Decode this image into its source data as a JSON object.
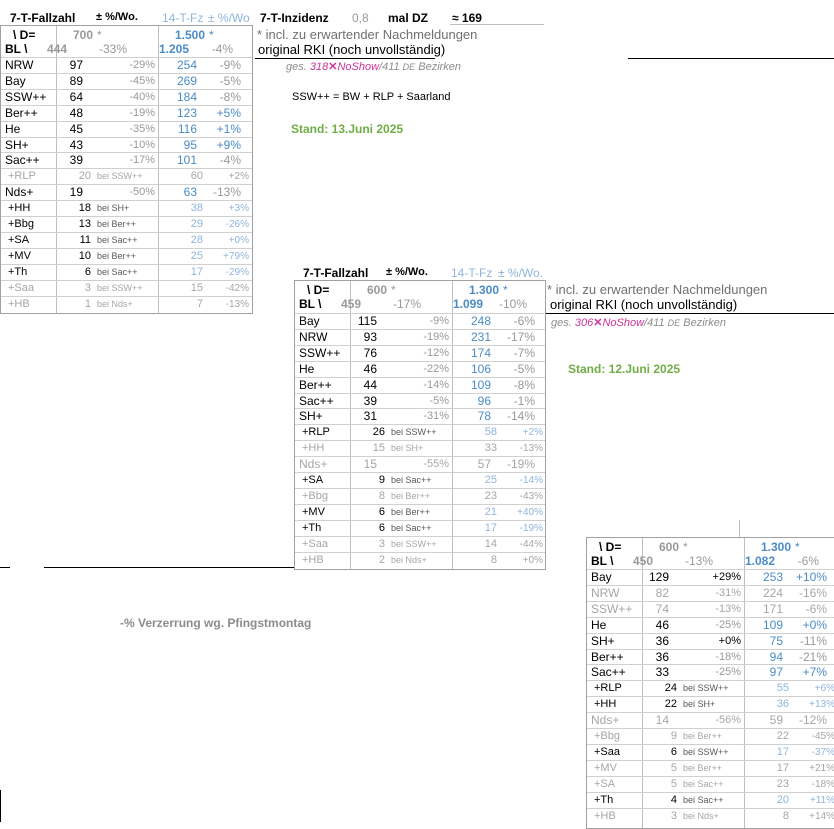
{
  "header": {
    "fallzahl_label": "7-T-Fallzahl",
    "pm_label": "± %/Wo.",
    "fz14_label": "14-T-Fz",
    "pm14_label": "± %/Wo",
    "inzidenz_label": "7-T-Inzidenz",
    "inzidenz_value": "0,8",
    "mal_dz": "mal DZ",
    "approx": "≈ 169"
  },
  "notes": {
    "incl_note": "* incl. zu erwartender Nachmeldungen",
    "original_note": "original RKI (noch unvollständig)",
    "ssw_formula": "SSW++  =  BW + RLP + Saarland",
    "pfingst": "-% Verzerrung wg. Pfingstmontag"
  },
  "table1": {
    "d_label": "\\ D=",
    "d_val": "700",
    "d_star": "*",
    "d14_val": "1.500",
    "d14_star": "*",
    "bl_label": "BL \\",
    "bl_val": "444",
    "bl_pct": "-33%",
    "bl14_val": "1.205",
    "bl14_pct": "-4%",
    "ges_prefix": "ges.",
    "ges_val": "318",
    "noshow_mark": "✕",
    "noshow": "NoShow",
    "ges_total": "/411",
    "de": "DE",
    "bezirken": "Bezirken",
    "stand": "Stand: 13.Juni 2025",
    "rows": [
      {
        "bl": "NRW",
        "v": "97",
        "p": "-29%",
        "v14": "254",
        "p14": "-9%",
        "t": "main"
      },
      {
        "bl": "Bay",
        "v": "89",
        "p": "-45%",
        "v14": "269",
        "p14": "-5%",
        "t": "main"
      },
      {
        "bl": "SSW++",
        "v": "64",
        "p": "-40%",
        "v14": "184",
        "p14": "-8%",
        "t": "main"
      },
      {
        "bl": "Ber++",
        "v": "48",
        "p": "-19%",
        "v14": "123",
        "p14": "+5%",
        "t": "main"
      },
      {
        "bl": "He",
        "v": "45",
        "p": "-35%",
        "v14": "116",
        "p14": "+1%",
        "t": "main"
      },
      {
        "bl": "SH+",
        "v": "43",
        "p": "-10%",
        "v14": "95",
        "p14": "+9%",
        "t": "main"
      },
      {
        "bl": "Sac++",
        "v": "39",
        "p": "-17%",
        "v14": "101",
        "p14": "-4%",
        "t": "main"
      },
      {
        "bl": "+RLP",
        "v": "20",
        "bei": "bei SSW++",
        "v14": "60",
        "p14": "+2%",
        "t": "sub-grey"
      },
      {
        "bl": "Nds+",
        "v": "19",
        "p": "-50%",
        "v14": "63",
        "p14": "-13%",
        "t": "main"
      },
      {
        "bl": "+HH",
        "v": "18",
        "bei": "bei SH+",
        "v14": "38",
        "p14": "+3%",
        "t": "sub"
      },
      {
        "bl": "+Bbg",
        "v": "13",
        "bei": "bei Ber++",
        "v14": "29",
        "p14": "-26%",
        "t": "sub"
      },
      {
        "bl": "+SA",
        "v": "11",
        "bei": "bei Sac++",
        "v14": "28",
        "p14": "+0%",
        "t": "sub"
      },
      {
        "bl": "+MV",
        "v": "10",
        "bei": "bei Ber++",
        "v14": "25",
        "p14": "+79%",
        "t": "sub"
      },
      {
        "bl": "+Th",
        "v": "6",
        "bei": "bei Sac++",
        "v14": "17",
        "p14": "-29%",
        "t": "sub"
      },
      {
        "bl": "+Saa",
        "v": "3",
        "bei": "bei SSW++",
        "v14": "15",
        "p14": "-42%",
        "t": "sub-grey"
      },
      {
        "bl": "+HB",
        "v": "1",
        "bei": "bei Nds+",
        "v14": "7",
        "p14": "-13%",
        "t": "sub-grey"
      }
    ]
  },
  "table2": {
    "title_label": "7-T-Fallzahl",
    "pm_label": "± %/Wo.",
    "fz14_label": "14-T-Fz",
    "pm14_label": "± %/Wo.",
    "d_label": "\\ D=",
    "d_val": "600",
    "d_star": "*",
    "d14_val": "1.300",
    "d14_star": "*",
    "bl_label": "BL \\",
    "bl_val": "459",
    "bl_pct": "-17%",
    "bl14_val": "1.099",
    "bl14_pct": "-10%",
    "ges_prefix": "ges.",
    "ges_val": "306",
    "noshow_mark": "✕",
    "noshow": "NoShow",
    "ges_total": "/411",
    "de": "DE",
    "bezirken": "Bezirken",
    "stand": "Stand: 12.Juni 2025",
    "rows": [
      {
        "bl": "Bay",
        "v": "115",
        "p": "-9%",
        "v14": "248",
        "p14": "-6%",
        "t": "main"
      },
      {
        "bl": "NRW",
        "v": "93",
        "p": "-19%",
        "v14": "231",
        "p14": "-17%",
        "t": "main"
      },
      {
        "bl": "SSW++",
        "v": "76",
        "p": "-12%",
        "v14": "174",
        "p14": "-7%",
        "t": "main"
      },
      {
        "bl": "He",
        "v": "46",
        "p": "-22%",
        "v14": "106",
        "p14": "-5%",
        "t": "main"
      },
      {
        "bl": "Ber++",
        "v": "44",
        "p": "-14%",
        "v14": "109",
        "p14": "-8%",
        "t": "main"
      },
      {
        "bl": "Sac++",
        "v": "39",
        "p": "-5%",
        "v14": "96",
        "p14": "-1%",
        "t": "main"
      },
      {
        "bl": "SH+",
        "v": "31",
        "p": "-31%",
        "v14": "78",
        "p14": "-14%",
        "t": "main"
      },
      {
        "bl": "+RLP",
        "v": "26",
        "bei": "bei SSW++",
        "v14": "58",
        "p14": "+2%",
        "t": "sub"
      },
      {
        "bl": "+HH",
        "v": "15",
        "bei": "bei SH+",
        "v14": "33",
        "p14": "-13%",
        "t": "sub-grey"
      },
      {
        "bl": "Nds+",
        "v": "15",
        "p": "-55%",
        "v14": "57",
        "p14": "-19%",
        "t": "main-grey"
      },
      {
        "bl": "+SA",
        "v": "9",
        "bei": "bei Sac++",
        "v14": "25",
        "p14": "-14%",
        "t": "sub"
      },
      {
        "bl": "+Bbg",
        "v": "8",
        "bei": "bei Ber++",
        "v14": "23",
        "p14": "-43%",
        "t": "sub-grey"
      },
      {
        "bl": "+MV",
        "v": "6",
        "bei": "bei Ber++",
        "v14": "21",
        "p14": "+40%",
        "t": "sub"
      },
      {
        "bl": "+Th",
        "v": "6",
        "bei": "bei Sac++",
        "v14": "17",
        "p14": "-19%",
        "t": "sub"
      },
      {
        "bl": "+Saa",
        "v": "3",
        "bei": "bei SSW++",
        "v14": "14",
        "p14": "-44%",
        "t": "sub-grey"
      },
      {
        "bl": "+HB",
        "v": "2",
        "bei": "bei Nds+",
        "v14": "8",
        "p14": "+0%",
        "t": "sub-grey"
      }
    ]
  },
  "table3": {
    "d_label": "\\ D=",
    "d_val": "600",
    "d_star": "*",
    "d14_val": "1.300",
    "d14_star": "*",
    "bl_label": "BL \\",
    "bl_val": "450",
    "bl_pct": "-13%",
    "bl14_val": "1.082",
    "bl14_pct": "-6%",
    "rows": [
      {
        "bl": "Bay",
        "v": "129",
        "p": "+29%",
        "v14": "253",
        "p14": "+10%",
        "t": "main"
      },
      {
        "bl": "NRW",
        "v": "82",
        "p": "-31%",
        "v14": "224",
        "p14": "-16%",
        "t": "main-grey"
      },
      {
        "bl": "SSW++",
        "v": "74",
        "p": "-13%",
        "v14": "171",
        "p14": "-6%",
        "t": "main-grey"
      },
      {
        "bl": "He",
        "v": "46",
        "p": "-25%",
        "v14": "109",
        "p14": "+0%",
        "t": "main"
      },
      {
        "bl": "SH+",
        "v": "36",
        "p": "+0%",
        "v14": "75",
        "p14": "-11%",
        "t": "main"
      },
      {
        "bl": "Ber++",
        "v": "36",
        "p": "-18%",
        "v14": "94",
        "p14": "-21%",
        "t": "main"
      },
      {
        "bl": "Sac++",
        "v": "33",
        "p": "-25%",
        "v14": "97",
        "p14": "+7%",
        "t": "main"
      },
      {
        "bl": "+RLP",
        "v": "24",
        "bei": "bei SSW++",
        "v14": "55",
        "p14": "+6%",
        "t": "sub"
      },
      {
        "bl": "+HH",
        "v": "22",
        "bei": "bei SH+",
        "v14": "36",
        "p14": "+13%",
        "t": "sub"
      },
      {
        "bl": "Nds+",
        "v": "14",
        "p": "-56%",
        "v14": "59",
        "p14": "-12%",
        "t": "main-grey"
      },
      {
        "bl": "+Bbg",
        "v": "9",
        "bei": "bei Ber++",
        "v14": "22",
        "p14": "-45%",
        "t": "sub-grey"
      },
      {
        "bl": "+Saa",
        "v": "6",
        "bei": "bei SSW++",
        "v14": "17",
        "p14": "-37%",
        "t": "sub"
      },
      {
        "bl": "+MV",
        "v": "5",
        "bei": "bei Ber++",
        "v14": "17",
        "p14": "+21%",
        "t": "sub-grey"
      },
      {
        "bl": "+SA",
        "v": "5",
        "bei": "bei Sac++",
        "v14": "23",
        "p14": "-18%",
        "t": "sub-grey"
      },
      {
        "bl": "+Th",
        "v": "4",
        "bei": "bei Sac++",
        "v14": "20",
        "p14": "+11%",
        "t": "sub"
      },
      {
        "bl": "+HB",
        "v": "3",
        "bei": "bei Nds+",
        "v14": "8",
        "p14": "+14%",
        "t": "sub-grey"
      }
    ]
  }
}
